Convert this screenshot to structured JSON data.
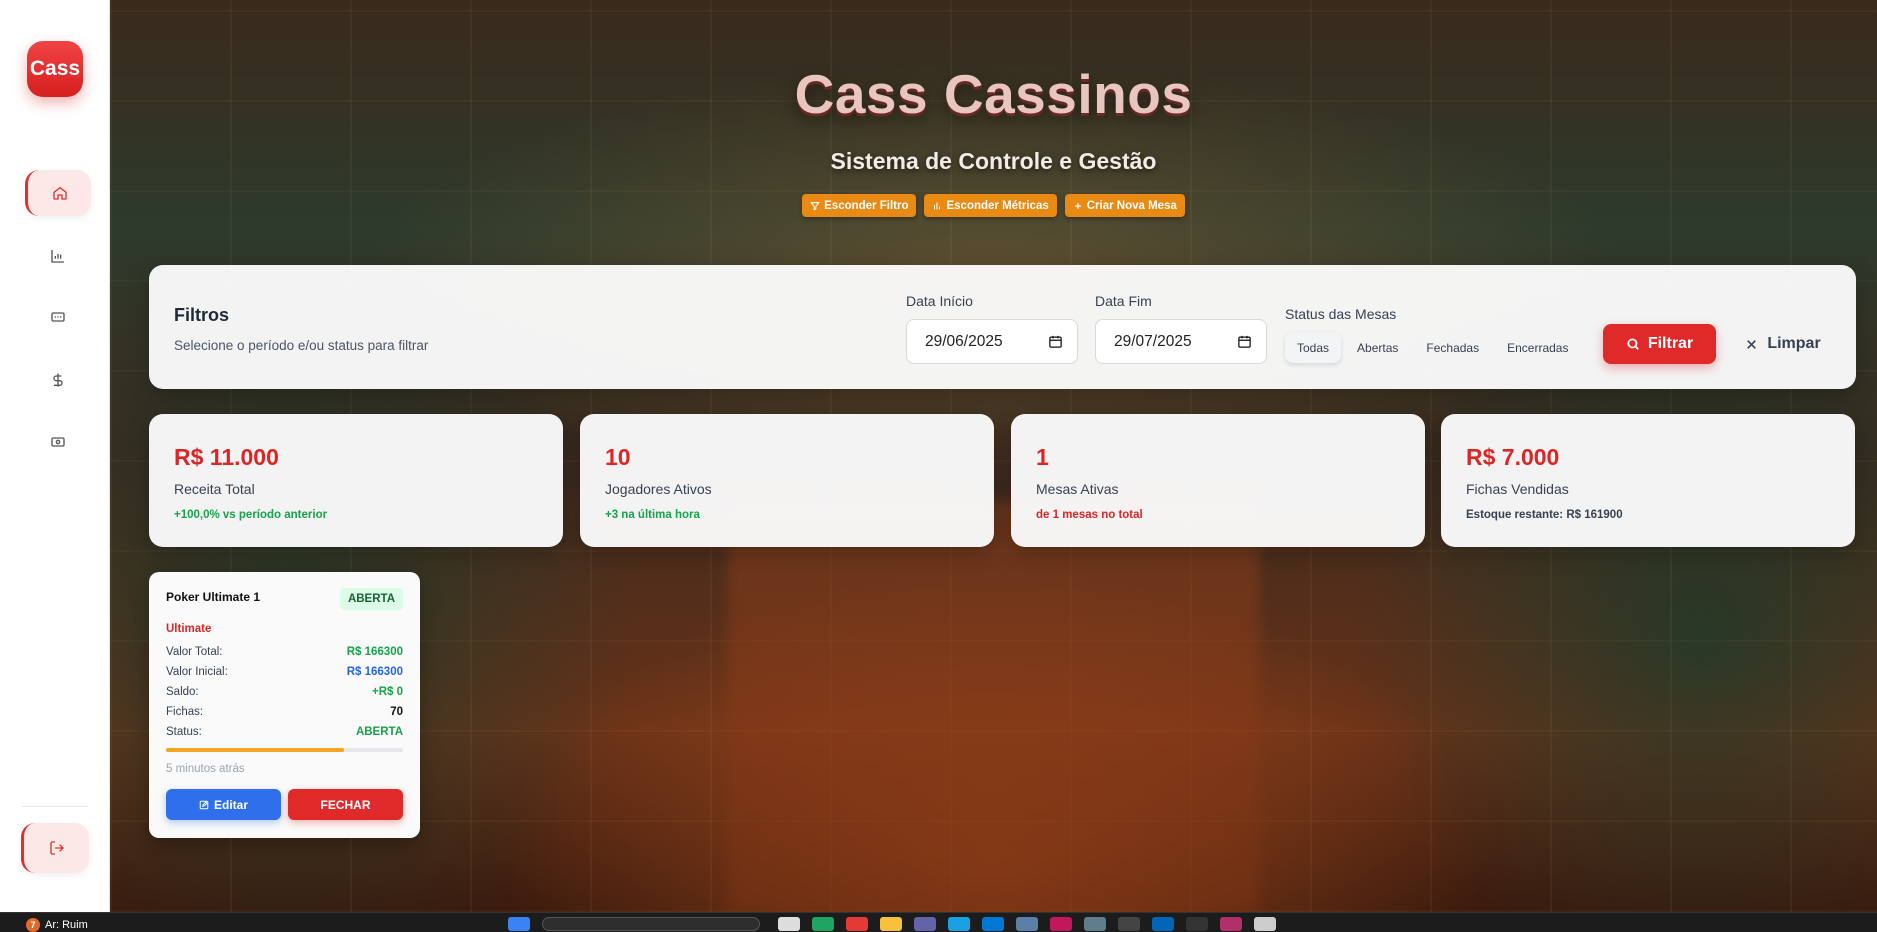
{
  "brand": {
    "logo_text": "Cass",
    "title": "Cass Cassinos",
    "subtitle": "Sistema de Controle e Gestão"
  },
  "sidebar": {
    "items": [
      {
        "icon": "home-icon",
        "active": true
      },
      {
        "icon": "chart-icon",
        "active": false
      },
      {
        "icon": "card-icon",
        "active": false
      },
      {
        "icon": "dollar-icon",
        "active": false
      },
      {
        "icon": "cash-icon",
        "active": false
      }
    ],
    "logout_icon": "logout-icon"
  },
  "header_actions": {
    "hide_filter": "Esconder Filtro",
    "hide_metrics": "Esconder Métricas",
    "create_table": "Criar Nova Mesa"
  },
  "filters": {
    "title": "Filtros",
    "subtitle": "Selecione o período e/ou status para filtrar",
    "start_label": "Data Início",
    "start_value": "29/06/2025",
    "end_label": "Data Fim",
    "end_value": "29/07/2025",
    "status_label": "Status das Mesas",
    "status_options": [
      "Todas",
      "Abertas",
      "Fechadas",
      "Encerradas"
    ],
    "status_selected": "Todas",
    "filter_button": "Filtrar",
    "clear_button": "Limpar"
  },
  "metrics": [
    {
      "value": "R$ 11.000",
      "label": "Receita Total",
      "note": "+100,0% vs período anterior",
      "note_color": "#16a34a"
    },
    {
      "value": "10",
      "label": "Jogadores Ativos",
      "note": "+3 na última hora",
      "note_color": "#16a34a"
    },
    {
      "value": "1",
      "label": "Mesas Ativas",
      "note": "de 1 mesas no total",
      "note_color": "#dc2626"
    },
    {
      "value": "R$ 7.000",
      "label": "Fichas Vendidas",
      "note": "Estoque restante: R$ 161900",
      "note_color": "#374151"
    }
  ],
  "tables": [
    {
      "name": "Poker Ultimate 1",
      "badge": "ABERTA",
      "type": "Ultimate",
      "rows": [
        {
          "label": "Valor Total:",
          "value": "R$ 166300",
          "color": "#16a34a"
        },
        {
          "label": "Valor Inicial:",
          "value": "R$ 166300",
          "color": "#2563eb"
        },
        {
          "label": "Saldo:",
          "value": "+R$ 0",
          "color": "#16a34a"
        },
        {
          "label": "Fichas:",
          "value": "70",
          "color": "#111111"
        },
        {
          "label": "Status:",
          "value": "ABERTA",
          "color": "#16a34a"
        }
      ],
      "progress": 0.75,
      "time": "5 minutos atrás",
      "edit_button": "Editar",
      "close_button": "FECHAR"
    }
  ],
  "taskbar": {
    "weather_badge": "7",
    "weather_text": "Ar: Ruim"
  },
  "colors": {
    "accent_red": "#e02a2a",
    "accent_orange": "#e88a13",
    "accent_blue": "#2f6fec"
  }
}
